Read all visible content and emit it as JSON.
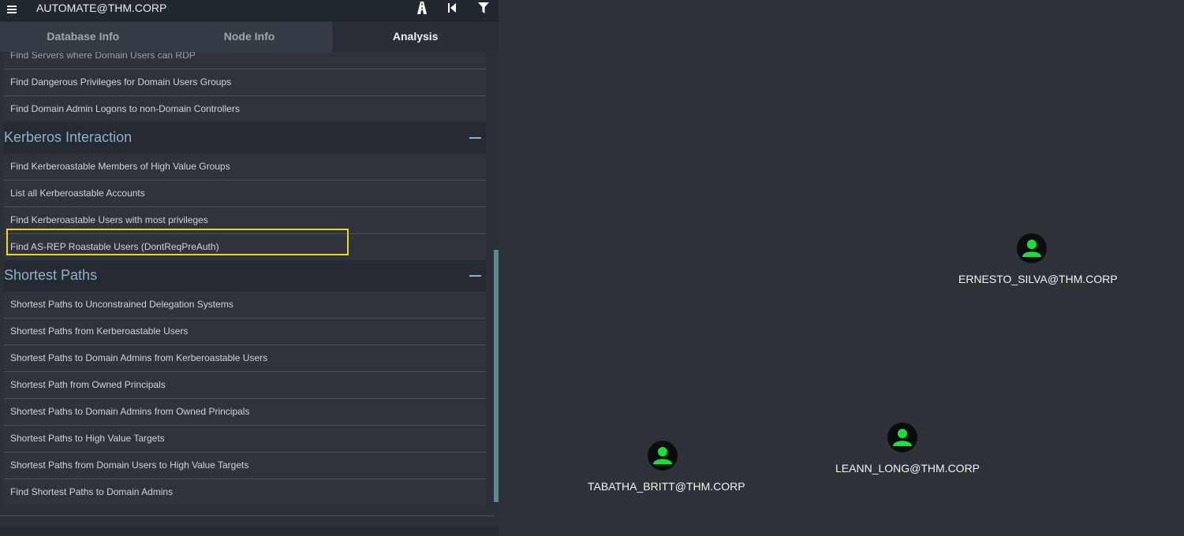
{
  "search": {
    "value": "AUTOMATE@THM.CORP"
  },
  "tabs": [
    {
      "label": "Database Info"
    },
    {
      "label": "Node Info"
    },
    {
      "label": "Analysis"
    }
  ],
  "analysis": {
    "partial_item": "Find Servers where Domain Users can RDP",
    "items_top": [
      "Find Dangerous Privileges for Domain Users Groups",
      "Find Domain Admin Logons to non-Domain Controllers"
    ],
    "kerberos": {
      "title": "Kerberos Interaction",
      "items": [
        "Find Kerberoastable Members of High Value Groups",
        "List all Kerberoastable Accounts",
        "Find Kerberoastable Users with most privileges",
        "Find AS-REP Roastable Users (DontReqPreAuth)"
      ]
    },
    "shortest": {
      "title": "Shortest Paths",
      "items": [
        "Shortest Paths to Unconstrained Delegation Systems",
        "Shortest Paths from Kerberoastable Users",
        "Shortest Paths to Domain Admins from Kerberoastable Users",
        "Shortest Path from Owned Principals",
        "Shortest Paths to Domain Admins from Owned Principals",
        "Shortest Paths to High Value Targets",
        "Shortest Paths from Domain Users to High Value Targets",
        "Find Shortest Paths to Domain Admins"
      ]
    }
  },
  "graph": {
    "nodes": [
      {
        "label": "ERNESTO_SILVA@THM.CORP",
        "icon": "user-icon"
      },
      {
        "label": "LEANN_LONG@THM.CORP",
        "icon": "user-icon"
      },
      {
        "label": "TABATHA_BRITT@THM.CORP",
        "icon": "user-icon"
      }
    ]
  },
  "colors": {
    "node_fill": "#19e038",
    "highlight": "#f0d61e",
    "section_title": "#8db3c8"
  }
}
